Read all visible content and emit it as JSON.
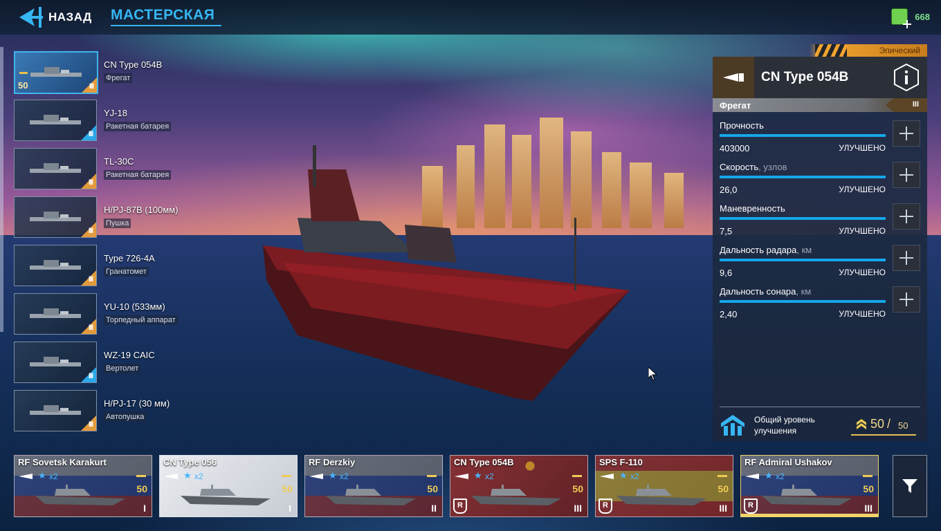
{
  "topbar": {
    "back_label": "НАЗАД",
    "title": "МАСТЕРСКАЯ",
    "currency_value": "668"
  },
  "weapons": [
    {
      "name": "CN Type 054B",
      "type": "Фрегат",
      "tier": "III",
      "level": "50",
      "active": true,
      "corner": "orange",
      "icon": "frigate-icon"
    },
    {
      "name": "YJ-18",
      "type": "Ракетная батарея",
      "tier": "III",
      "active": false,
      "corner": "blue",
      "icon": "missile-icon"
    },
    {
      "name": "TL-30C",
      "type": "Ракетная батарея",
      "tier": "III",
      "active": false,
      "corner": "orange",
      "icon": "missile-icon"
    },
    {
      "name": "H/PJ-87B (100мм)",
      "type": "Пушка",
      "tier": "III",
      "active": false,
      "corner": "orange",
      "icon": "cannon-icon"
    },
    {
      "name": "Type 726-4A",
      "type": "Гранатомет",
      "tier": "III",
      "active": false,
      "corner": "orange",
      "icon": "launcher-icon"
    },
    {
      "name": "YU-10 (533мм)",
      "type": "Торпедный аппарат",
      "tier": "III",
      "active": false,
      "corner": "orange",
      "icon": "torpedo-icon"
    },
    {
      "name": "WZ-19 CAIC",
      "type": "Вертолет",
      "tier": "III",
      "active": false,
      "corner": "blue",
      "icon": "helicopter-icon"
    },
    {
      "name": "H/PJ-17 (30 мм)",
      "type": "Автопушка",
      "tier": "III",
      "active": false,
      "corner": "orange",
      "icon": "autocannon-icon"
    }
  ],
  "panel": {
    "rarity": "Эпический",
    "ship_name": "CN Type 054B",
    "ship_type": "Фрегат",
    "tier": "III",
    "stats": [
      {
        "name": "Прочность",
        "unit": "",
        "value": "403000",
        "status": "УЛУЧШЕНО"
      },
      {
        "name": "Скорость",
        "unit": ", узлов",
        "value": "26,0",
        "status": "УЛУЧШЕНО"
      },
      {
        "name": "Маневренность",
        "unit": "",
        "value": "7,5",
        "status": "УЛУЧШЕНО"
      },
      {
        "name": "Дальность радара",
        "unit": ", км",
        "value": "9,6",
        "status": "УЛУЧШЕНО"
      },
      {
        "name": "Дальность сонара",
        "unit": ", км",
        "value": "2,40",
        "status": "УЛУЧШЕНО"
      }
    ],
    "overall_label": "Общий уровень улучшения",
    "overall_current": "50",
    "overall_sep": "/",
    "overall_max": "50"
  },
  "ships": [
    {
      "name": "RF Sovetsk Karakurt",
      "mult": "x2",
      "level": "50",
      "tier": "I",
      "style": "dark",
      "flag": "ru",
      "rbadge": false,
      "selected": false
    },
    {
      "name": "CN Type 056",
      "mult": "x2",
      "level": "50",
      "tier": "I",
      "style": "white",
      "flag": "cn",
      "rbadge": false,
      "selected": false
    },
    {
      "name": "RF Derzkiy",
      "mult": "x2",
      "level": "50",
      "tier": "II",
      "style": "dark",
      "flag": "ru",
      "rbadge": false,
      "selected": false
    },
    {
      "name": "CN Type 054B",
      "mult": "x2",
      "level": "50",
      "tier": "III",
      "style": "dark",
      "flag": "cn",
      "rbadge": true,
      "rbadge_letter": "R",
      "selected": false
    },
    {
      "name": "SPS F-110",
      "mult": "x2",
      "level": "50",
      "tier": "III",
      "style": "dark",
      "flag": "es",
      "rbadge": true,
      "rbadge_letter": "R",
      "selected": false
    },
    {
      "name": "RF Admiral Ushakov",
      "mult": "x2",
      "level": "50",
      "tier": "III",
      "style": "dark",
      "flag": "ru",
      "rbadge": true,
      "rbadge_letter": "R",
      "selected": true
    }
  ],
  "colors": {
    "accent_blue": "#36b6f2",
    "stat_bar": "#15a7ea",
    "rarity_orange": "#f0a42f",
    "level_gold": "#f0cc55",
    "currency_green": "#7fe08a"
  }
}
